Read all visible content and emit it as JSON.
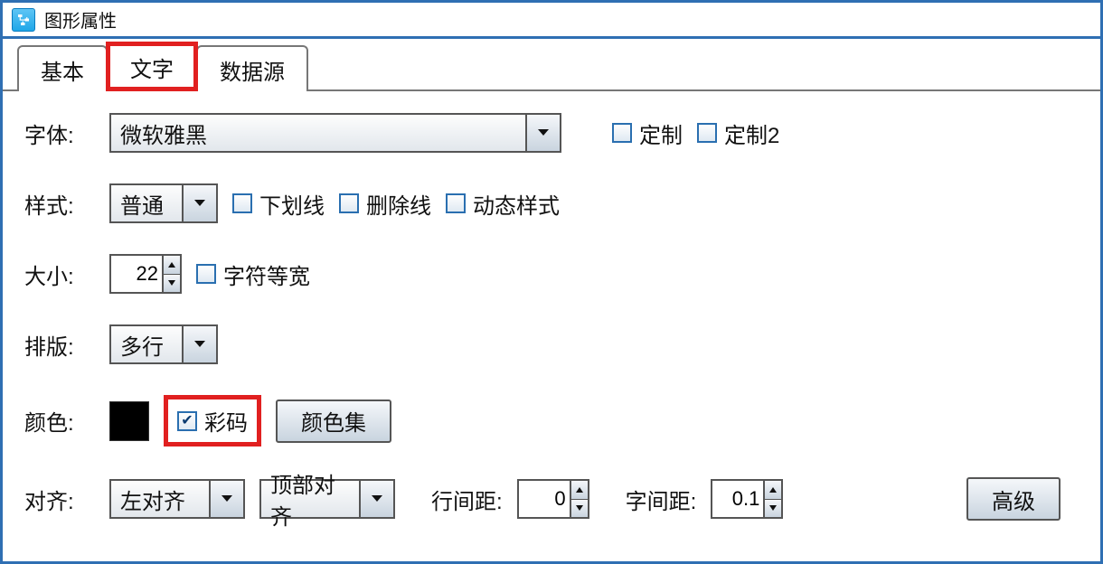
{
  "window": {
    "title": "图形属性"
  },
  "tabs": {
    "basic": "基本",
    "text": "文字",
    "datasource": "数据源"
  },
  "labels": {
    "font": "字体:",
    "style": "样式:",
    "size": "大小:",
    "layout": "排版:",
    "color": "颜色:",
    "align": "对齐:",
    "lineSpacing": "行间距:",
    "charSpacing": "字间距:"
  },
  "font": {
    "value": "微软雅黑",
    "custom": "定制",
    "custom2": "定制2"
  },
  "style": {
    "value": "普通",
    "underline": "下划线",
    "strike": "删除线",
    "dynamic": "动态样式"
  },
  "size": {
    "value": "22",
    "monowidth": "字符等宽"
  },
  "layout": {
    "value": "多行"
  },
  "color": {
    "swatch": "#000000",
    "colorcode": "彩码",
    "colorset": "颜色集"
  },
  "align": {
    "h": "左对齐",
    "v": "顶部对齐",
    "lineSpacing": "0",
    "charSpacing": "0.1",
    "advanced": "高级"
  }
}
